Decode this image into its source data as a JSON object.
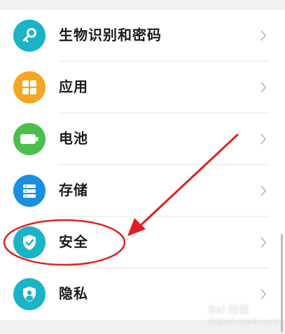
{
  "settings_list": {
    "items": [
      {
        "label": "生物识别和密码",
        "icon": "key-icon",
        "color": "#1bb3c6"
      },
      {
        "label": "应用",
        "icon": "apps-grid-icon",
        "color": "#f5a623"
      },
      {
        "label": "电池",
        "icon": "battery-icon",
        "color": "#4bbf4b"
      },
      {
        "label": "存储",
        "icon": "storage-icon",
        "color": "#1a8fe0"
      },
      {
        "label": "安全",
        "icon": "shield-check-icon",
        "color": "#1bb3c6"
      },
      {
        "label": "隐私",
        "icon": "privacy-icon",
        "color": "#1bb3c6"
      }
    ]
  },
  "annotation": {
    "arrow_color": "#e0201e",
    "circled_item": "安全"
  },
  "watermark": {
    "text": "Bai 经验",
    "subtext": "jingyan.baidu.com"
  }
}
